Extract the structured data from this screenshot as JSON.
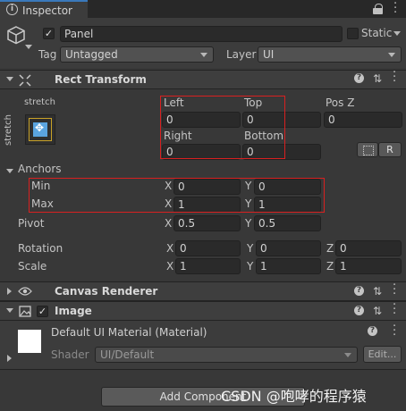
{
  "window": {
    "tab_label": "Inspector",
    "tab_icon": "info-icon",
    "lock_icon": "lock-icon",
    "more_icon": "kebab-menu-icon"
  },
  "object": {
    "name": "Panel",
    "active": true,
    "static_label": "Static",
    "static_checked": false,
    "tag_label": "Tag",
    "tag_value": "Untagged",
    "layer_label": "Layer",
    "layer_value": "UI"
  },
  "rect_transform": {
    "title": "Rect Transform",
    "anchor_preset_top": "stretch",
    "anchor_preset_side": "stretch",
    "left_label": "Left",
    "left_value": "0",
    "top_label": "Top",
    "top_value": "0",
    "posz_label": "Pos Z",
    "posz_value": "0",
    "right_label": "Right",
    "right_value": "0",
    "bottom_label": "Bottom",
    "bottom_value": "0",
    "raw_edit_label": "R",
    "anchors_label": "Anchors",
    "min_label": "Min",
    "min_x_label": "X",
    "min_x": "0",
    "min_y_label": "Y",
    "min_y": "0",
    "max_label": "Max",
    "max_x_label": "X",
    "max_x": "1",
    "max_y_label": "Y",
    "max_y": "1",
    "pivot_label": "Pivot",
    "pivot_x_label": "X",
    "pivot_x": "0.5",
    "pivot_y_label": "Y",
    "pivot_y": "0.5",
    "rotation_label": "Rotation",
    "rot_x_label": "X",
    "rot_x": "0",
    "rot_y_label": "Y",
    "rot_y": "0",
    "rot_z_label": "Z",
    "rot_z": "0",
    "scale_label": "Scale",
    "scale_x_label": "X",
    "scale_x": "1",
    "scale_y_label": "Y",
    "scale_y": "1",
    "scale_z_label": "Z",
    "scale_z": "1"
  },
  "canvas_renderer": {
    "title": "Canvas Renderer"
  },
  "image": {
    "title": "Image",
    "enabled": true,
    "material_name": "Default UI Material (Material)",
    "shader_label": "Shader",
    "shader_value": "UI/Default",
    "edit_label": "Edit..."
  },
  "footer": {
    "add_component_label": "Add Component",
    "watermark": "CSDN @咆哮的程序猿"
  },
  "colors": {
    "background": "#383838",
    "header": "#3e3e3e",
    "field": "#2a2a2a",
    "highlight": "#d82020",
    "accent": "#3a79bb"
  }
}
